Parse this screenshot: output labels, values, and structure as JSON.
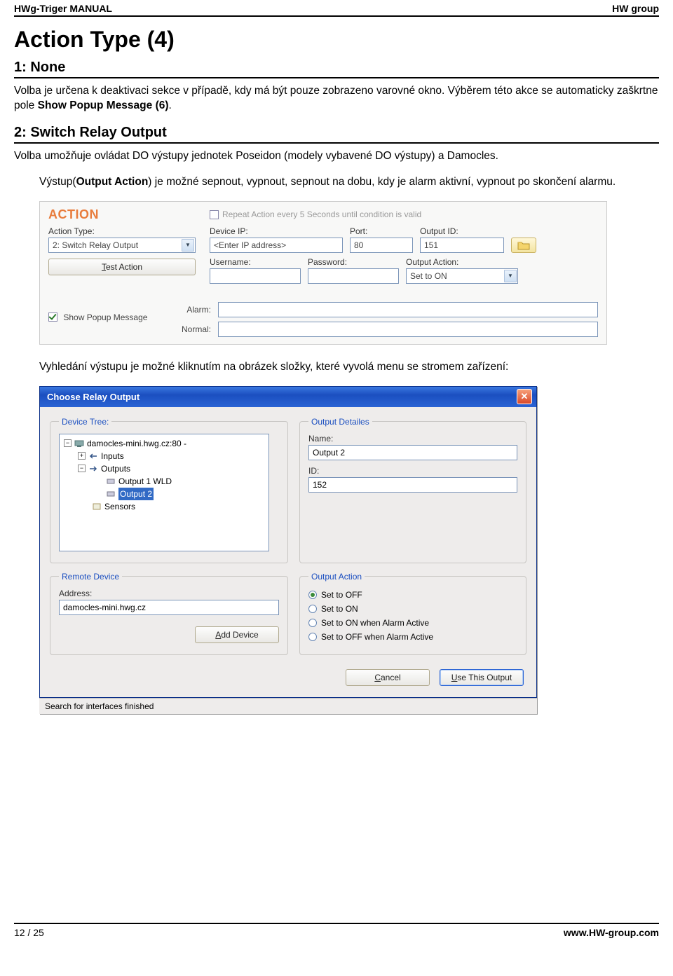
{
  "header": {
    "left": "HWg-Triger MANUAL",
    "right": "HW group"
  },
  "title": "Action Type (4)",
  "sec1": {
    "heading": "1: None",
    "para_a": "Volba je určena k deaktivaci sekce v případě, kdy má být pouze zobrazeno varovné okno. Výběrem této akce se automaticky zaškrtne pole ",
    "para_b": "Show Popup Message (6)",
    "para_c": "."
  },
  "sec2": {
    "heading": "2: Switch Relay Output",
    "para1": "Volba umožňuje ovládat DO výstupy jednotek Poseidon (modely vybavené DO výstupy) a Damocles.",
    "para2_a": "Výstup(",
    "para2_b": "Output Action",
    "para2_c": ") je možné sepnout, vypnout, sepnout na dobu, kdy je alarm aktivní, vypnout po skončení alarmu."
  },
  "action_panel": {
    "title": "ACTION",
    "repeat_label": "Repeat Action every 5 Seconds until condition is valid",
    "action_type_label": "Action Type:",
    "action_type_value": "2: Switch Relay Output",
    "test_button": "Test Action",
    "device_ip_label": "Device IP:",
    "device_ip_value": "<Enter IP address>",
    "port_label": "Port:",
    "port_value": "80",
    "output_id_label": "Output ID:",
    "output_id_value": "151",
    "username_label": "Username:",
    "password_label": "Password:",
    "output_action_label": "Output Action:",
    "output_action_value": "Set to ON",
    "show_popup_label": "Show Popup Message",
    "alarm_label": "Alarm:",
    "normal_label": "Normal:"
  },
  "mid_para": "Vyhledání výstupu je možné kliknutím na obrázek složky, které vyvolá menu se stromem zařízení:",
  "dialog": {
    "title": "Choose  Relay Output",
    "tree_legend": "Device Tree:",
    "tree": {
      "root": "damocles-mini.hwg.cz:80 -",
      "inputs": "Inputs",
      "outputs": "Outputs",
      "out1": "Output 1 WLD",
      "out2": "Output 2",
      "sensors": "Sensors"
    },
    "details_legend": "Output Detailes",
    "name_label": "Name:",
    "name_value": "Output 2",
    "id_label": "ID:",
    "id_value": "152",
    "remote_legend": "Remote Device",
    "address_label": "Address:",
    "address_value": "damocles-mini.hwg.cz",
    "add_device": "Add Device",
    "action_legend": "Output Action",
    "radios": [
      "Set to OFF",
      "Set to ON",
      "Set to ON when Alarm Active",
      "Set to OFF when Alarm Active"
    ],
    "cancel": "Cancel",
    "use": "Use This Output",
    "status": "Search for interfaces finished"
  },
  "footer": {
    "page": "12 / 25",
    "url": "www.HW-group.com"
  }
}
